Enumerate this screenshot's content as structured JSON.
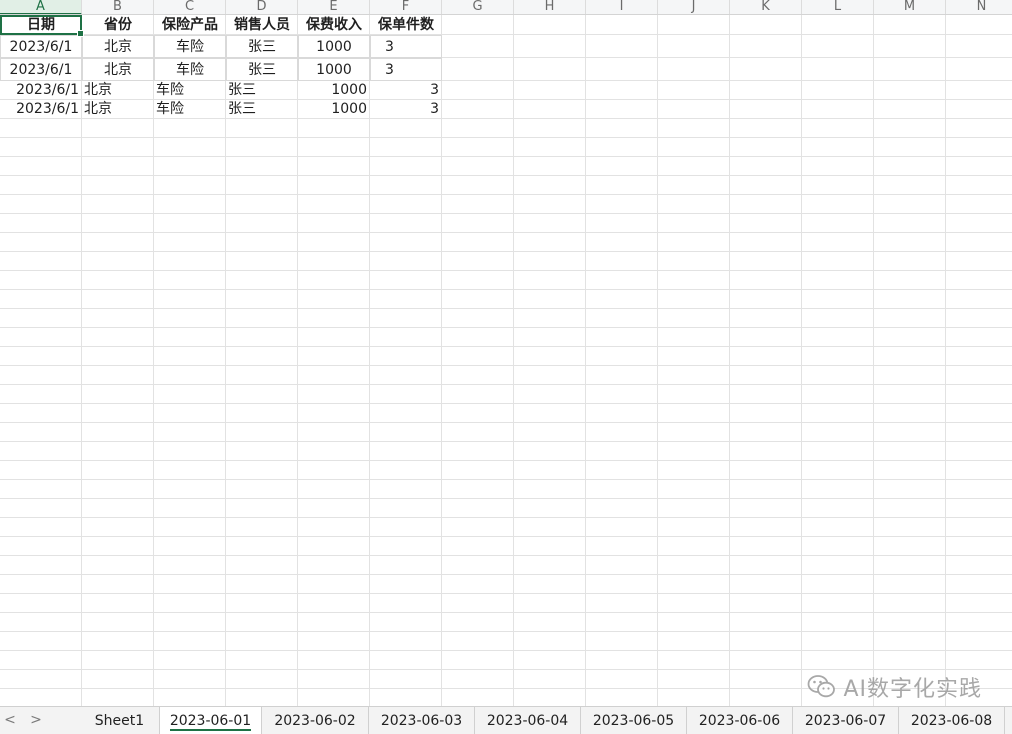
{
  "columns": [
    "A",
    "B",
    "C",
    "D",
    "E",
    "F",
    "G",
    "H",
    "I",
    "J",
    "K",
    "L",
    "M",
    "N"
  ],
  "selected_column": "A",
  "header_row": [
    "日期",
    "省份",
    "保险产品",
    "销售人员",
    "保费收入",
    "保单件数"
  ],
  "rows": [
    [
      "2023/6/1",
      "北京",
      "车险",
      "张三",
      "1000",
      "3"
    ],
    [
      "2023/6/1",
      "北京",
      "车险",
      "张三",
      "1000",
      "3"
    ],
    [
      "2023/6/1",
      "北京",
      "车险",
      "张三",
      "1000",
      "3"
    ],
    [
      "2023/6/1",
      "北京",
      "车险",
      "张三",
      "1000",
      "3"
    ]
  ],
  "sheet_tabs": [
    "Sheet1",
    "2023-06-01",
    "2023-06-02",
    "2023-06-03",
    "2023-06-04",
    "2023-06-05",
    "2023-06-06",
    "2023-06-07",
    "2023-06-08"
  ],
  "active_tab": "2023-06-01",
  "nav": {
    "prev": "<",
    "next": ">"
  },
  "watermark": "AI数字化实践",
  "colors": {
    "accent": "#1e7145",
    "grid": "#e2e2e2"
  }
}
